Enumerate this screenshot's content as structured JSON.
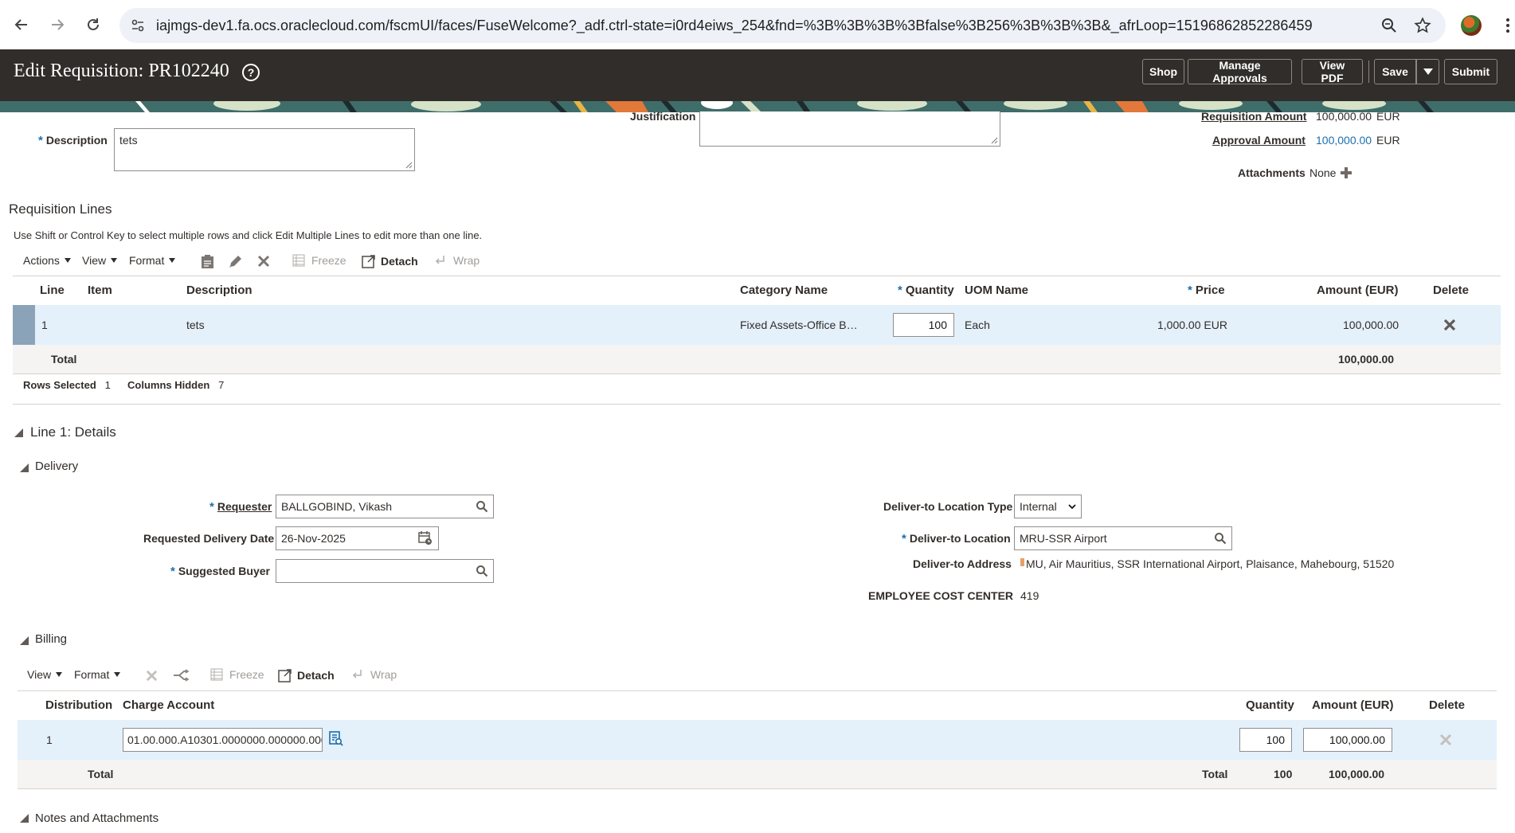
{
  "browser": {
    "url": "iajmgs-dev1.fa.ocs.oraclecloud.com/fscmUI/faces/FuseWelcome?_adf.ctrl-state=i0rd4eiws_254&fnd=%3B%3B%3B%3Bfalse%3B256%3B%3B%3B&_afrLoop=15196862852286459"
  },
  "header": {
    "title": "Edit Requisition: PR102240",
    "buttons": {
      "shop": "Shop",
      "manage_approvals": "Manage Approvals",
      "view_pdf": "View PDF",
      "save": "Save",
      "submit": "Submit"
    }
  },
  "top_form": {
    "description_label": "Description",
    "description_value": "tets",
    "justification_label": "Justification",
    "requisition_amount_label": "Requisition Amount",
    "requisition_amount_value": "100,000.00",
    "requisition_amount_currency": "EUR",
    "approval_amount_label": "Approval Amount",
    "approval_amount_value": "100,000.00",
    "approval_amount_currency": "EUR",
    "attachments_label": "Attachments",
    "attachments_value": "None"
  },
  "requisition_lines": {
    "title": "Requisition Lines",
    "hint": "Use Shift or Control Key to select multiple rows and click Edit Multiple Lines to edit more than one line.",
    "toolbar": {
      "actions": "Actions",
      "view": "View",
      "format": "Format",
      "freeze": "Freeze",
      "detach": "Detach",
      "wrap": "Wrap"
    },
    "columns": {
      "line": "Line",
      "item": "Item",
      "description": "Description",
      "category": "Category Name",
      "quantity": "Quantity",
      "uom": "UOM Name",
      "price": "Price",
      "amount": "Amount (EUR)",
      "delete": "Delete"
    },
    "rows": [
      {
        "line": "1",
        "item": "",
        "description": "tets",
        "category": "Fixed Assets-Office B…",
        "quantity": "100",
        "uom": "Each",
        "price": "1,000.00 EUR",
        "amount": "100,000.00"
      }
    ],
    "total_label": "Total",
    "total_amount": "100,000.00",
    "rows_selected_label": "Rows Selected",
    "rows_selected_value": "1",
    "columns_hidden_label": "Columns Hidden",
    "columns_hidden_value": "7"
  },
  "line_details": {
    "title": "Line 1: Details",
    "delivery": {
      "title": "Delivery",
      "requester_label": "Requester",
      "requester_value": "BALLGOBIND, Vikash",
      "requested_date_label": "Requested Delivery Date",
      "requested_date_value": "26-Nov-2025",
      "suggested_buyer_label": "Suggested Buyer",
      "suggested_buyer_value": "",
      "location_type_label": "Deliver-to Location Type",
      "location_type_value": "Internal",
      "location_label": "Deliver-to Location",
      "location_value": "MRU-SSR Airport",
      "address_label": "Deliver-to Address",
      "address_value": "MU, Air Mauritius, SSR International Airport, Plaisance, Mahebourg, 51520",
      "cost_center_label": "EMPLOYEE COST CENTER",
      "cost_center_value": "419"
    },
    "billing": {
      "title": "Billing",
      "toolbar": {
        "view": "View",
        "format": "Format",
        "freeze": "Freeze",
        "detach": "Detach",
        "wrap": "Wrap"
      },
      "columns": {
        "distribution": "Distribution",
        "charge_account": "Charge Account",
        "quantity": "Quantity",
        "amount": "Amount (EUR)",
        "delete": "Delete"
      },
      "rows": [
        {
          "distribution": "1",
          "charge_account": "01.00.000.A10301.0000000.000000.000",
          "quantity": "100",
          "amount": "100,000.00"
        }
      ],
      "total_label": "Total",
      "total_label_2": "Total",
      "total_quantity": "100",
      "total_amount": "100,000.00"
    },
    "notes_title": "Notes and Attachments"
  }
}
